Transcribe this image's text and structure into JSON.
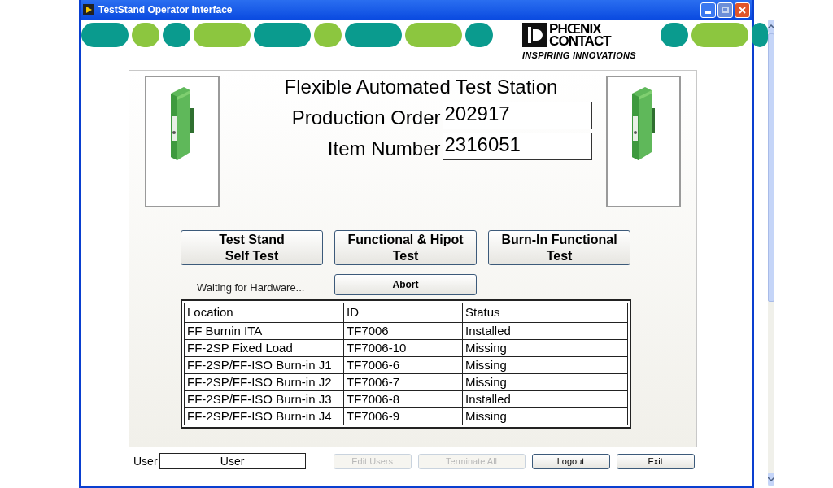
{
  "window": {
    "title": "TestStand Operator Interface"
  },
  "logo": {
    "name_lines": [
      "PHŒNIX",
      "CONTACT"
    ],
    "tagline": "INSPIRING INNOVATIONS"
  },
  "header": {
    "title": "Flexible Automated Test Station",
    "fields": [
      {
        "label": "Production Order",
        "value": "202917"
      },
      {
        "label": "Item Number",
        "value": "2316051"
      }
    ]
  },
  "test_buttons": [
    {
      "lines": [
        "Test Stand",
        "Self Test"
      ]
    },
    {
      "lines": [
        "Functional & Hipot",
        "Test"
      ]
    },
    {
      "lines": [
        "Burn-In Functional",
        "Test"
      ]
    }
  ],
  "status_text": "Waiting for Hardware...",
  "abort_button": "Abort",
  "table": {
    "columns": [
      "Location",
      "ID",
      "Status"
    ],
    "rows": [
      [
        "FF Burnin ITA",
        "TF7006",
        "Installed"
      ],
      [
        "FF-2SP Fixed Load",
        "TF7006-10",
        "Missing"
      ],
      [
        "FF-2SP/FF-ISO Burn-in J1",
        "TF7006-6",
        "Missing"
      ],
      [
        "FF-2SP/FF-ISO Burn-in J2",
        "TF7006-7",
        "Missing"
      ],
      [
        "FF-2SP/FF-ISO Burn-in J3",
        "TF7006-8",
        "Installed"
      ],
      [
        "FF-2SP/FF-ISO Burn-in J4",
        "TF7006-9",
        "Missing"
      ]
    ]
  },
  "footer": {
    "user_label": "User",
    "user_value": "User",
    "buttons": [
      {
        "label": "Edit Users",
        "disabled": true
      },
      {
        "label": "Terminate All",
        "disabled": true
      },
      {
        "label": "Logout",
        "disabled": false
      },
      {
        "label": "Exit",
        "disabled": false
      }
    ]
  }
}
